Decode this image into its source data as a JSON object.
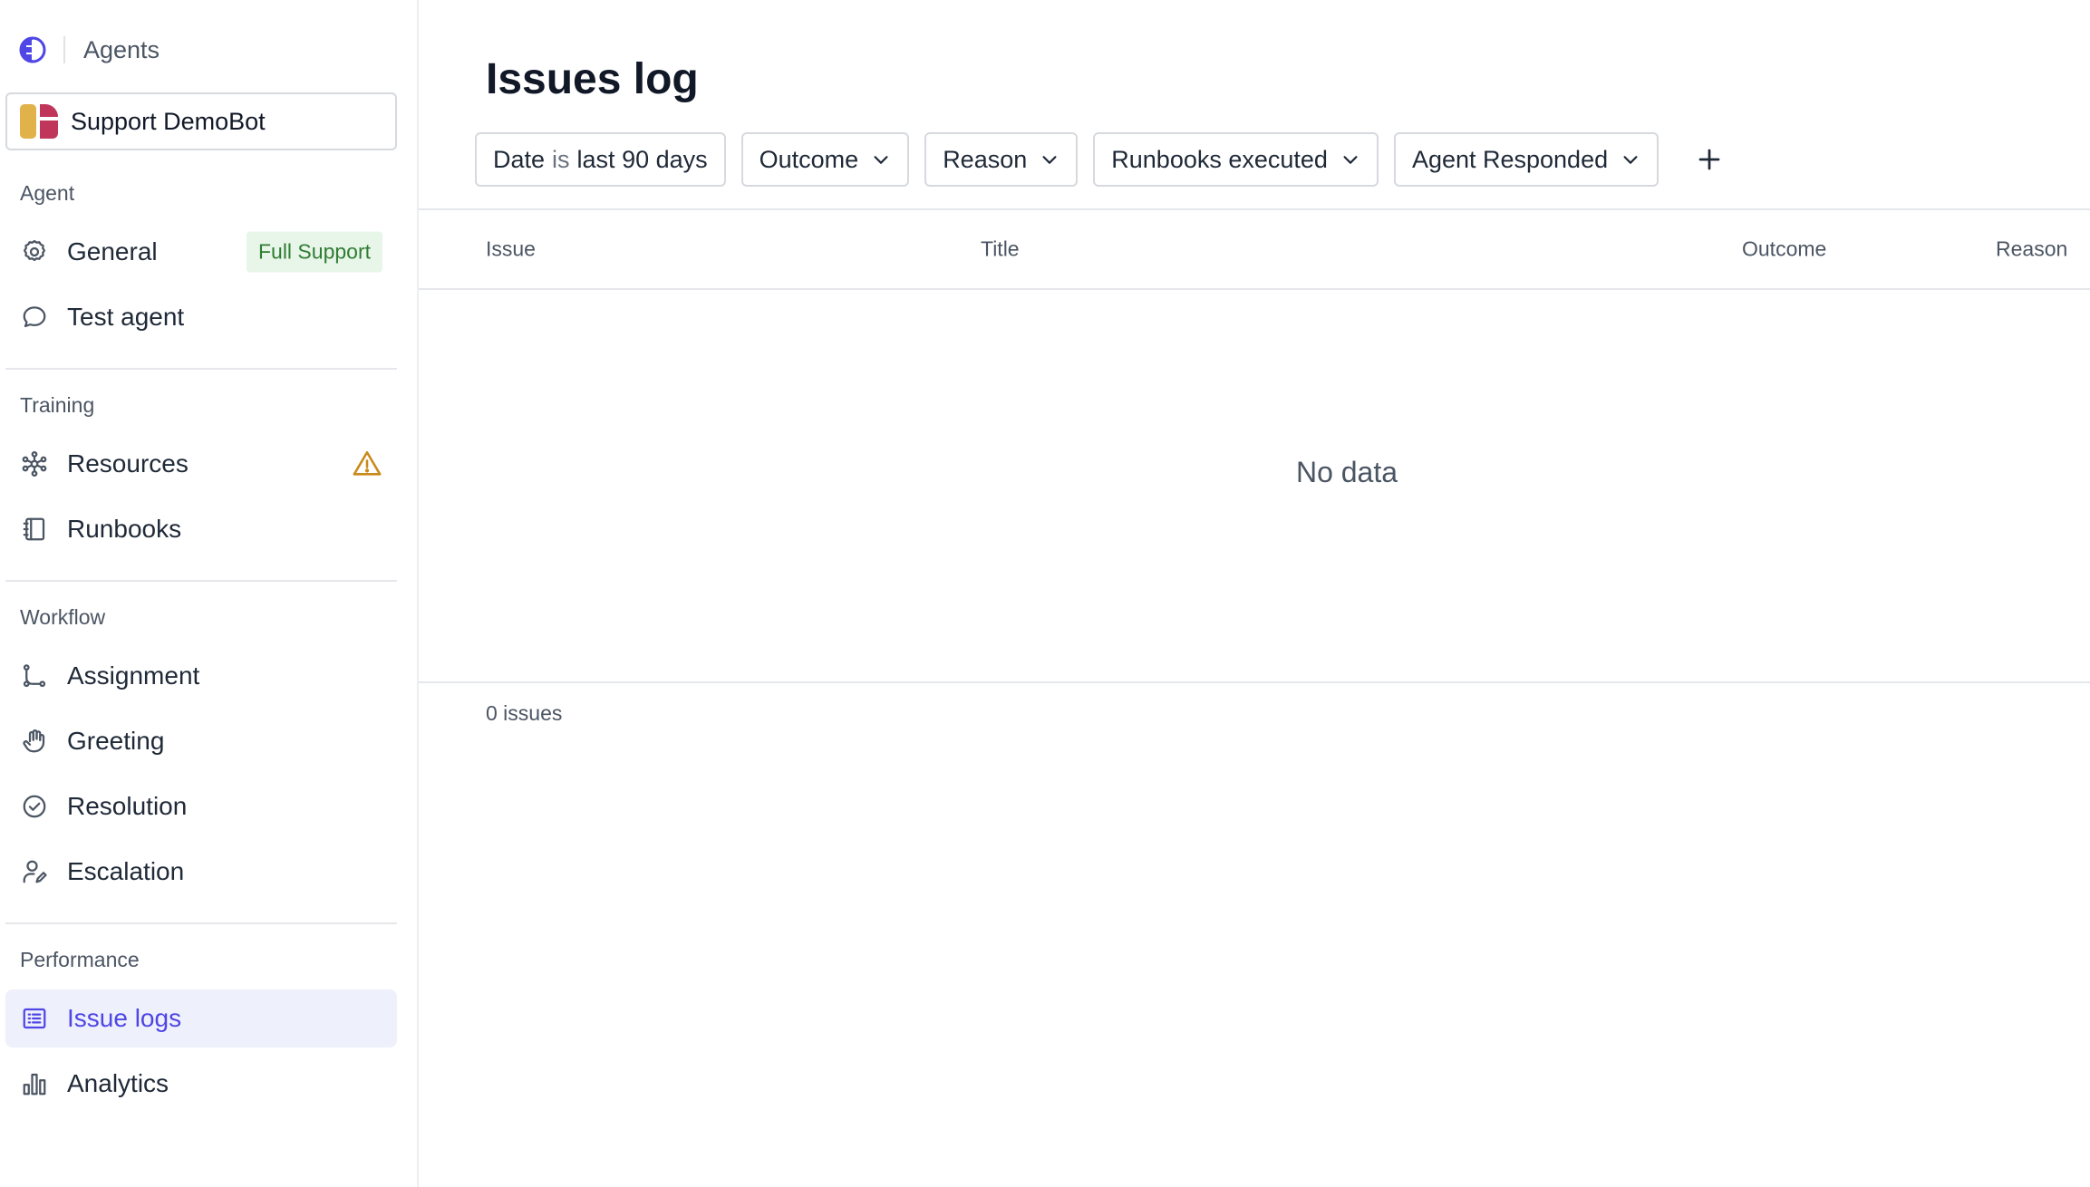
{
  "header": {
    "title": "Agents"
  },
  "bot": {
    "name": "Support DemoBot"
  },
  "sidebar": {
    "sections": [
      {
        "label": "Agent"
      },
      {
        "label": "Training"
      },
      {
        "label": "Workflow"
      },
      {
        "label": "Performance"
      }
    ],
    "items": {
      "general": {
        "label": "General",
        "badge": "Full Support",
        "icon": "gear-icon"
      },
      "test_agent": {
        "label": "Test agent",
        "icon": "chat-bubble-icon"
      },
      "resources": {
        "label": "Resources",
        "icon": "network-icon",
        "trail_icon": "warning-icon"
      },
      "runbooks": {
        "label": "Runbooks",
        "icon": "notebook-icon"
      },
      "assignment": {
        "label": "Assignment",
        "icon": "route-icon"
      },
      "greeting": {
        "label": "Greeting",
        "icon": "hand-icon"
      },
      "resolution": {
        "label": "Resolution",
        "icon": "check-circle-icon"
      },
      "escalation": {
        "label": "Escalation",
        "icon": "user-edit-icon"
      },
      "issue_logs": {
        "label": "Issue logs",
        "icon": "list-icon",
        "active": true
      },
      "analytics": {
        "label": "Analytics",
        "icon": "bar-chart-icon"
      }
    }
  },
  "main": {
    "title": "Issues log",
    "filters": {
      "date": {
        "field": "Date",
        "op": "is",
        "value": "last 90 days"
      },
      "outcome": "Outcome",
      "reason": "Reason",
      "runbooks": "Runbooks executed",
      "agent_responded": "Agent Responded"
    },
    "columns": [
      "Issue",
      "Title",
      "Outcome",
      "Reason"
    ],
    "empty_text": "No data",
    "count_text": "0 issues"
  },
  "colors": {
    "accent": "#4f46e5",
    "active_bg": "#eef0fc",
    "badge_bg": "#e8f5e9",
    "badge_text": "#2e7d32",
    "warning": "#c98a1a"
  }
}
